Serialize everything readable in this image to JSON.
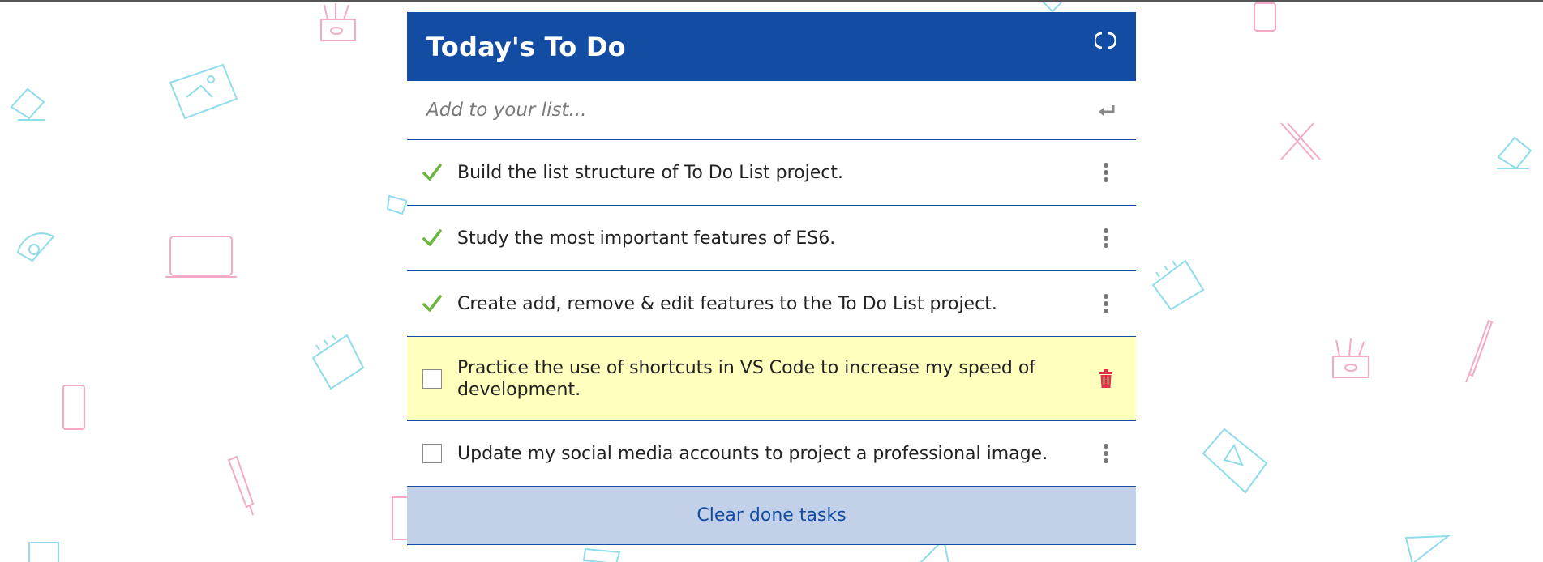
{
  "header": {
    "title": "Today's To Do",
    "refresh_icon": "refresh-icon"
  },
  "add_input": {
    "placeholder": "Add to your list...",
    "value": "",
    "submit_icon": "enter-icon"
  },
  "tasks": [
    {
      "text": "Build the list structure of To Do List project.",
      "completed": true,
      "action_icon": "more-vertical-icon"
    },
    {
      "text": "Study the most important features of ES6.",
      "completed": true,
      "action_icon": "more-vertical-icon"
    },
    {
      "text": "Create add, remove & edit features to the To Do List project.",
      "completed": true,
      "action_icon": "more-vertical-icon"
    },
    {
      "text": "Practice the use of shortcuts in VS Code to increase my speed of development.",
      "completed": false,
      "highlighted": true,
      "action_icon": "trash-icon"
    },
    {
      "text": "Update my social media accounts to project a professional image.",
      "completed": false,
      "action_icon": "more-vertical-icon"
    }
  ],
  "footer": {
    "clear_label": "Clear done tasks"
  },
  "colors": {
    "header_bg": "#134da3",
    "check": "#6cb43f",
    "highlight_bg": "#ffffbe",
    "trash": "#e0314b",
    "clear_bg": "#c3d1e8",
    "deco_pink": "#f4a9c8",
    "deco_cyan": "#8fdcea"
  }
}
